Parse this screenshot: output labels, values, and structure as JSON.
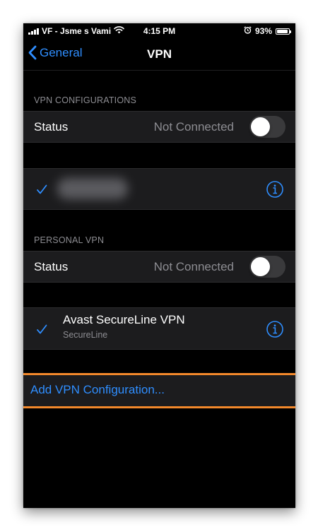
{
  "statusbar": {
    "carrier": "VF - Jsme s Vami",
    "time": "4:15 PM",
    "battery": "93%",
    "battery_level": 0.93
  },
  "navbar": {
    "back_label": "General",
    "title": "VPN"
  },
  "vpn_configurations": {
    "header": "VPN CONFIGURATIONS",
    "status_label": "Status",
    "status_value": "Not Connected",
    "status_toggle_on": false
  },
  "personal_vpn": {
    "header": "PERSONAL VPN",
    "status_label": "Status",
    "status_value": "Not Connected",
    "status_toggle_on": false,
    "profile": {
      "name": "Avast SecureLine VPN",
      "subtitle": "SecureLine"
    }
  },
  "add_configuration_label": "Add VPN Configuration...",
  "colors": {
    "accent": "#2f8eff",
    "highlight": "#f2882b",
    "cell_bg": "#1c1c1e",
    "secondary_text": "#8d8d92"
  },
  "icons": [
    "signal-icon",
    "wifi-icon",
    "alarm-icon",
    "battery-icon",
    "back-chevron-icon",
    "checkmark-icon",
    "info-icon"
  ]
}
